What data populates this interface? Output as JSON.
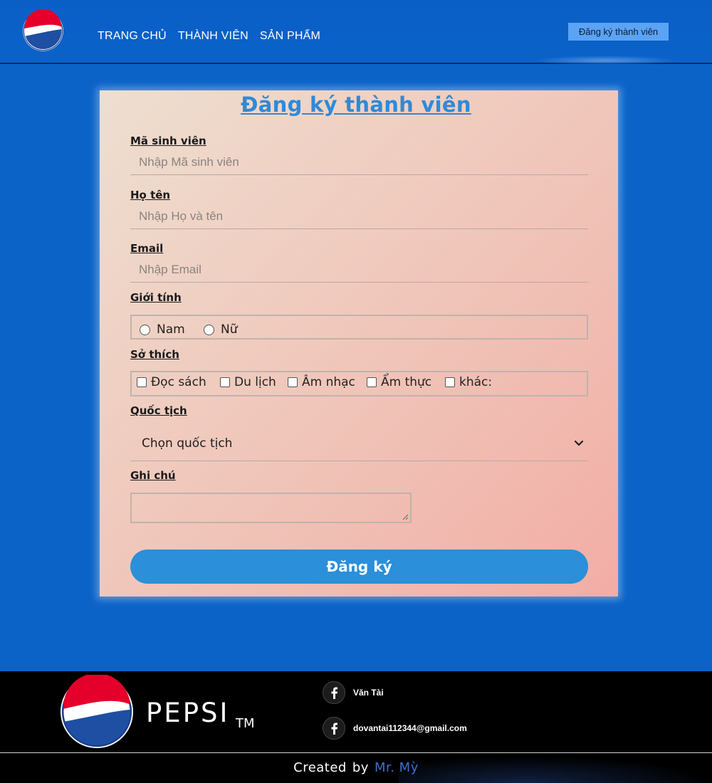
{
  "header": {
    "nav": [
      {
        "label": "TRANG CHỦ"
      },
      {
        "label": "THÀNH VIÊN"
      },
      {
        "label": "SẢN PHẨM"
      }
    ],
    "register_button": "Đăng ký thành viên"
  },
  "form": {
    "title": "Đăng ký thành viên",
    "student_id": {
      "label": "Mã sinh viên",
      "placeholder": "Nhập Mã sinh viên"
    },
    "full_name": {
      "label": "Họ tên",
      "placeholder": "Nhập Họ và tên"
    },
    "email": {
      "label": "Email",
      "placeholder": "Nhập Email"
    },
    "gender": {
      "label": "Giới tính",
      "options": [
        "Nam",
        "Nữ"
      ]
    },
    "hobbies": {
      "label": "Sở thích",
      "options": [
        "Đọc sách",
        "Du lịch",
        "Âm nhạc",
        "Ẩm thực",
        "khác:"
      ]
    },
    "nationality": {
      "label": "Quốc tịch",
      "selected": "Chọn quốc tịch"
    },
    "note": {
      "label": "Ghi chú"
    },
    "submit": "Đăng ký"
  },
  "footer": {
    "brand": "PEPSI",
    "tm": "TM",
    "contacts": [
      {
        "icon": "facebook-icon",
        "text": "Văn Tài"
      },
      {
        "icon": "facebook-icon",
        "text": "dovantai112344@gmail.com"
      }
    ],
    "created_prefix": "Created",
    "created_by": "by",
    "author": "Mr. Mỳ"
  },
  "colors": {
    "page_bg": "#0b63c8",
    "header_button": "#5aa3f5",
    "accent": "#2b8fd9",
    "footer_bg": "#000000"
  }
}
